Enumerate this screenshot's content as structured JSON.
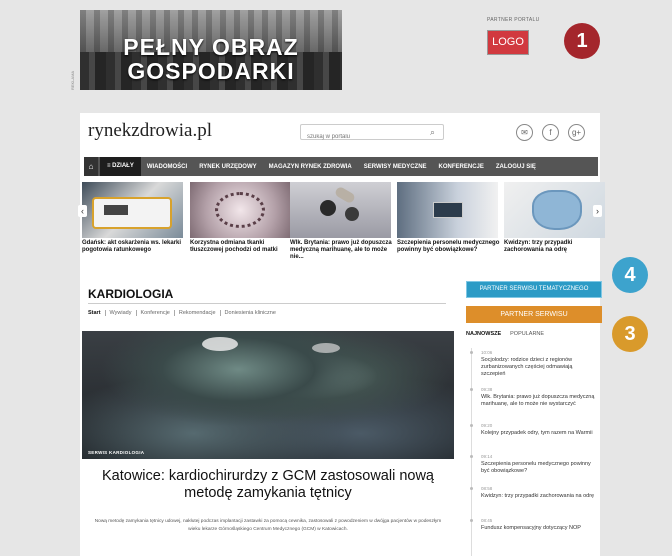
{
  "banner": {
    "line1": "PEŁNY OBRAZ",
    "line2": "GOSPODARKI",
    "ad_label": "REKLAMA"
  },
  "partner_portal": {
    "label": "PARTNER PORTALU",
    "logo": "LOGO",
    "marker": "1"
  },
  "markers": {
    "m4": "4",
    "m3": "3"
  },
  "site": {
    "logo_bold": "rynek",
    "logo_rest": "zdrowia.pl"
  },
  "search": {
    "placeholder": "szukaj w portalu"
  },
  "nav": {
    "dzialy": "≡ DZIAŁY",
    "items": [
      "WIADOMOŚCI",
      "RYNEK URZĘDOWY",
      "MAGAZYN RYNEK ZDROWIA",
      "SERWISY MEDYCZNE",
      "KONFERENCJE",
      "ZALOGUJ SIĘ"
    ]
  },
  "carousel": [
    {
      "caption": "Gdańsk: akt oskarżenia ws. lekarki pogotowia ratunkowego"
    },
    {
      "caption": "Korzystna odmiana tkanki tłuszczowej pochodzi od matki"
    },
    {
      "caption": "Wlk. Brytania: prawo już dopuszcza medyczną marihuanę, ale to może nie..."
    },
    {
      "caption": "Szczepienia personelu medycznego powinny być obowiązkowe?"
    },
    {
      "caption": "Kwidzyn: trzy przypadki zachorowania na odrę"
    }
  ],
  "section": {
    "title": "KARDIOLOGIA",
    "subnav": [
      "Start",
      "Wywiady",
      "Konferencje",
      "Rekomendacje",
      "Doniesienia kliniczne"
    ]
  },
  "hero": {
    "tag": "SERWIS KARDIOLOGIA",
    "headline": "Katowice: kardiochirurdzy z GCM zastosowali nową metodę zamykania tętnicy",
    "lead": "Nową metodę zamykania tętnicy udowej, nakłutej podczas implantacji zastawki za pomocą cewnika, zastosowali z powodzeniem w dwójga pacjentów w podeszłym wieku lekarze Górnośląskiego Centrum Medycznego (GCM) w Katowicach."
  },
  "sidebar": {
    "partner_tematyczny": "PARTNER SERWISU TEMATYCZNEGO",
    "partner": "PARTNER SERWISU",
    "tab_newest": "NAJNOWSZE",
    "tab_popular": "POPULARNE",
    "feed": [
      {
        "time": "10:06",
        "text": "Socjolodzy: rodzice dzieci z regionów zurbanizowanych częściej odmawiają szczepień"
      },
      {
        "time": "09:38",
        "text": "Wlk. Brytania: prawo już dopuszcza medyczną marihuanę, ale to może nie wystarczyć"
      },
      {
        "time": "09:20",
        "text": "Kolejny przypadek odry, tym razem na Warmii"
      },
      {
        "time": "09:14",
        "text": "Szczepienia personelu medycznego powinny być obowiązkowe?"
      },
      {
        "time": "08:58",
        "text": "Kwidzyn: trzy przypadki zachorowania na odrę"
      },
      {
        "time": "08:45",
        "text": "Fundusz kompensacyjny dotyczący NOP"
      }
    ]
  }
}
